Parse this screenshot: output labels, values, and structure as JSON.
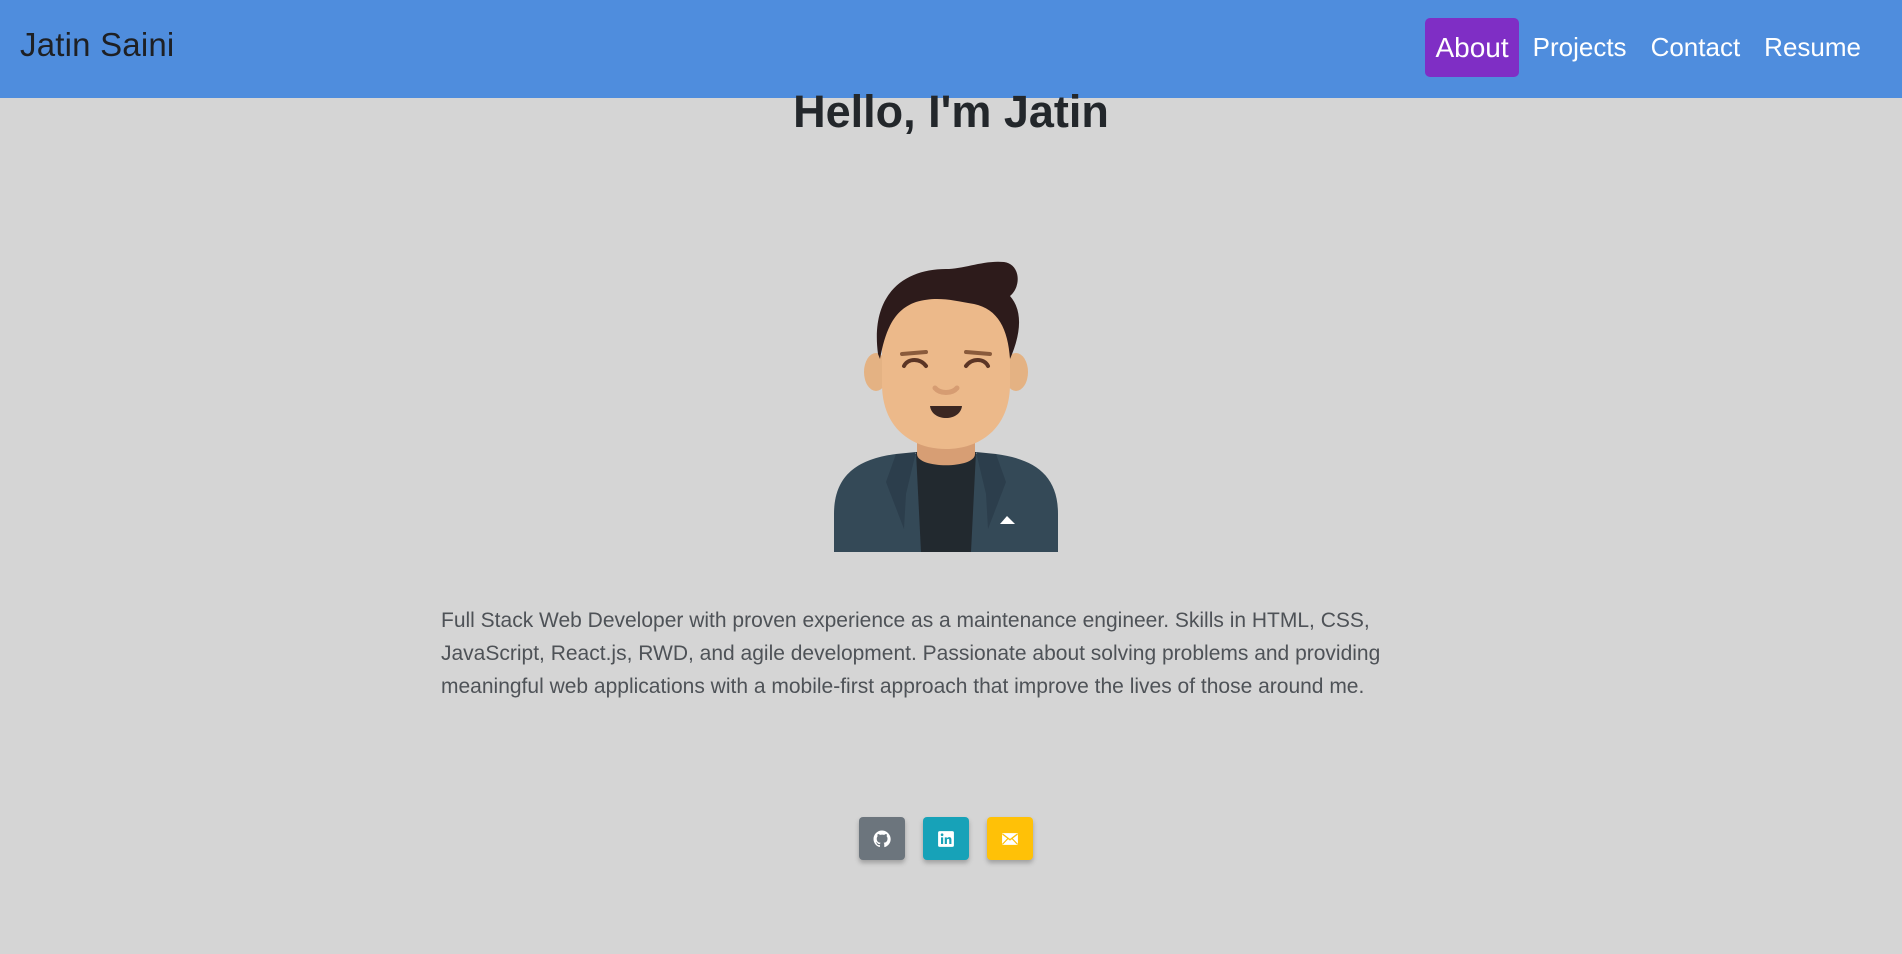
{
  "brand": "Jatin Saini",
  "nav": {
    "items": [
      {
        "label": "About",
        "active": true
      },
      {
        "label": "Projects",
        "active": false
      },
      {
        "label": "Contact",
        "active": false
      },
      {
        "label": "Resume",
        "active": false
      }
    ]
  },
  "hero": {
    "title": "Hello, I'm Jatin",
    "description": "Full Stack Web Developer with proven experience as a maintenance engineer. Skills in HTML, CSS, JavaScript, React.js, RWD, and agile development. Passionate about solving problems and providing meaningful web applications with a mobile-first approach that improve the lives of those around me."
  },
  "socials": [
    {
      "icon": "github-icon",
      "color": "#6c757d"
    },
    {
      "icon": "linkedin-icon",
      "color": "#17a2b8"
    },
    {
      "icon": "envelope-icon",
      "color": "#ffc107"
    }
  ],
  "colors": {
    "navbar": "#4f8ddd",
    "active_nav": "#7f2ec5",
    "background": "#d5d5d5"
  }
}
